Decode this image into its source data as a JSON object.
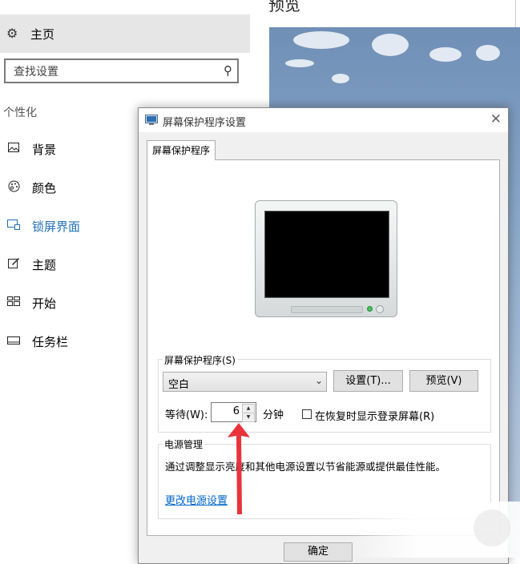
{
  "settings": {
    "home_label": "主页",
    "search_placeholder": "查找设置",
    "section_label": "个性化",
    "nav_items": [
      {
        "label": "背景",
        "icon": "picture-icon"
      },
      {
        "label": "颜色",
        "icon": "palette-icon"
      },
      {
        "label": "锁屏界面",
        "icon": "lock-screen-icon",
        "active": true
      },
      {
        "label": "主题",
        "icon": "theme-icon"
      },
      {
        "label": "开始",
        "icon": "start-icon"
      },
      {
        "label": "任务栏",
        "icon": "taskbar-icon"
      }
    ],
    "preview_title": "预览",
    "accent_color": "#1f6fb4"
  },
  "dialog": {
    "title": "屏幕保护程序设置",
    "tab_label": "屏幕保护程序",
    "screensaver_group_title": "屏幕保护程序(S)",
    "screensaver_selected": "空白",
    "settings_button": "设置(T)...",
    "preview_button": "预览(V)",
    "wait_label": "等待(W):",
    "wait_value": "6",
    "wait_unit": "分钟",
    "resume_logon_label": "在恢复时显示登录屏幕(R)",
    "resume_logon_checked": false,
    "power_group_title": "电源管理",
    "power_description": "通过调整显示亮度和其他电源设置以节省能源或提供最佳性能。",
    "power_link": "更改电源设置",
    "ok_button": "确定"
  },
  "annotation": {
    "arrow_color": "#e8333b"
  }
}
